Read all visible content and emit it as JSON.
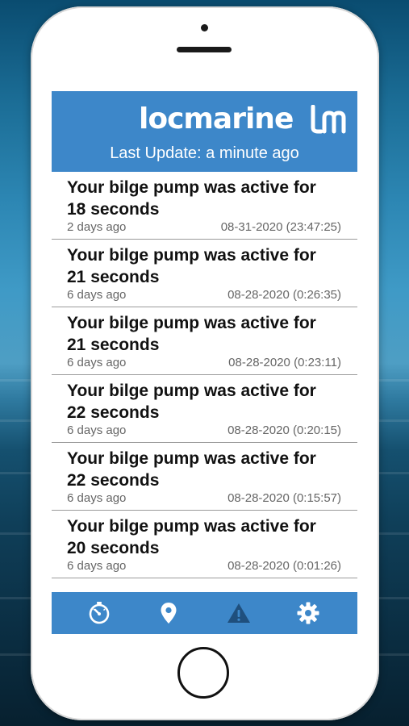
{
  "app": {
    "brand": "locmarine",
    "brand_mark": "lm",
    "last_update": "Last Update: a minute ago"
  },
  "notifications": [
    {
      "title": "Your bilge pump was active for 18 seconds",
      "ago": "2 days ago",
      "timestamp": "08-31-2020 (23:47:25)"
    },
    {
      "title": "Your bilge pump was active for 21 seconds",
      "ago": "6 days ago",
      "timestamp": "08-28-2020 (0:26:35)"
    },
    {
      "title": "Your bilge pump was active for 21 seconds",
      "ago": "6 days ago",
      "timestamp": "08-28-2020 (0:23:11)"
    },
    {
      "title": "Your bilge pump was active for 22 seconds",
      "ago": "6 days ago",
      "timestamp": "08-28-2020 (0:20:15)"
    },
    {
      "title": "Your bilge pump was active for 22 seconds",
      "ago": "6 days ago",
      "timestamp": "08-28-2020 (0:15:57)"
    },
    {
      "title": "Your bilge pump was active for 20 seconds",
      "ago": "6 days ago",
      "timestamp": "08-28-2020 (0:01:26)"
    }
  ],
  "tabbar": {
    "items": [
      {
        "icon": "stopwatch-icon"
      },
      {
        "icon": "map-pin-icon"
      },
      {
        "icon": "warning-icon",
        "active": true
      },
      {
        "icon": "gear-icon"
      }
    ]
  },
  "colors": {
    "brand_blue": "#3d87c9",
    "active_tab_icon": "#1f4f7d",
    "inactive_tab_icon": "#ffffff"
  }
}
